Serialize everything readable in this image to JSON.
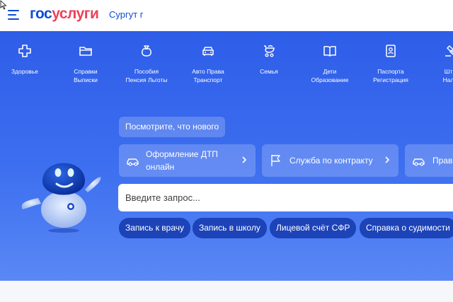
{
  "header": {
    "logo_part1": "гос",
    "logo_part2": "услуги",
    "city": "Сургут г"
  },
  "categories": [
    {
      "icon": "plus-cross-icon",
      "line1": "Здоровье",
      "line2": ""
    },
    {
      "icon": "folder-icon",
      "line1": "Справки",
      "line2": "Выписки"
    },
    {
      "icon": "money-bag-icon",
      "line1": "Пособия",
      "line2": "Пенсия Льготы"
    },
    {
      "icon": "car-icon",
      "line1": "Авто Права",
      "line2": "Транспорт"
    },
    {
      "icon": "stroller-icon",
      "line1": "Семья",
      "line2": ""
    },
    {
      "icon": "open-book-icon",
      "line1": "Дети",
      "line2": "Образование"
    },
    {
      "icon": "passport-icon",
      "line1": "Паспорта",
      "line2": "Регистрация"
    },
    {
      "icon": "gavel-icon",
      "line1": "Штр",
      "line2": "Нало"
    }
  ],
  "news_button": "Посмотрите, что нового",
  "cards": [
    {
      "icon": "car-outline-icon",
      "line1": "Оформление ДТП",
      "line2": "онлайн"
    },
    {
      "icon": "flag-icon",
      "line1": "Служба по контракту",
      "line2": ""
    },
    {
      "icon": "car-outline-icon",
      "line1": "Прав",
      "line2": ""
    }
  ],
  "search": {
    "placeholder": "Введите запрос..."
  },
  "quick_links": [
    "Запись к врачу",
    "Запись в школу",
    "Лицевой счёт СФР",
    "Справка о судимости"
  ],
  "colors": {
    "brand_blue": "#0d4cd3",
    "brand_red": "#ee3f58",
    "hero_blue": "#3d6ff0",
    "pill_blue": "#1d43b8"
  }
}
